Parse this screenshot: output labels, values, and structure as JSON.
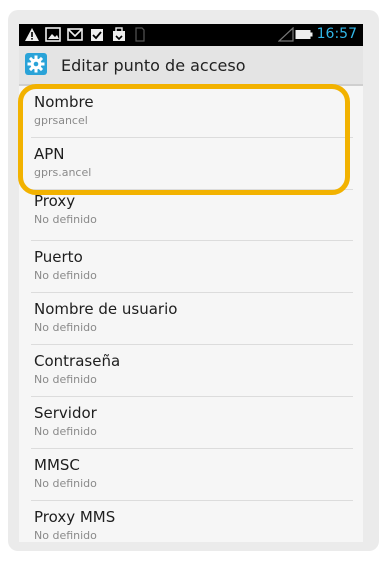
{
  "status_bar": {
    "time": "16:57",
    "icons": [
      "warning-icon",
      "image-icon",
      "mail-icon",
      "download-icon",
      "update-icon",
      "sim-icon",
      "signal-icon",
      "battery-icon"
    ]
  },
  "action_bar": {
    "icon": "gear-icon",
    "title": "Editar punto de acceso"
  },
  "settings": [
    {
      "label": "Nombre",
      "value": "gprsancel"
    },
    {
      "label": "APN",
      "value": "gprs.ancel"
    },
    {
      "label": "Proxy",
      "value": "No definido"
    },
    {
      "label": "Puerto",
      "value": "No definido"
    },
    {
      "label": "Nombre de usuario",
      "value": "No definido"
    },
    {
      "label": "Contraseña",
      "value": "No definido"
    },
    {
      "label": "Servidor",
      "value": "No definido"
    },
    {
      "label": "MMSC",
      "value": "No definido"
    },
    {
      "label": "Proxy MMS",
      "value": "No definido"
    }
  ],
  "highlight_color": "#f2b200",
  "accent_color": "#31b6e7"
}
